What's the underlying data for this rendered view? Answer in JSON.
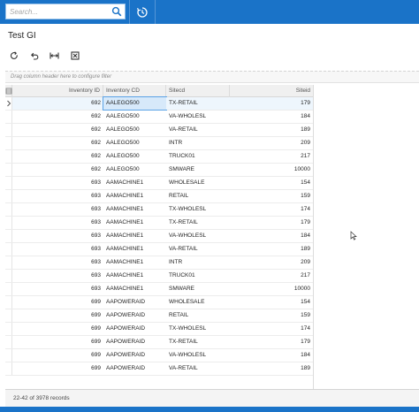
{
  "search": {
    "placeholder": "Search..."
  },
  "page": {
    "title": "Test GI"
  },
  "group_bar": {
    "hint": "Drag column header here to configure filter"
  },
  "grid": {
    "columns": [
      "Inventory ID",
      "Inventory CD",
      "Sitecd",
      "Siteid"
    ],
    "rows": [
      [
        "692",
        "AALEGO500",
        "TX-RETAIL",
        "179"
      ],
      [
        "692",
        "AALEGO500",
        "VA-WHOLESL",
        "184"
      ],
      [
        "692",
        "AALEGO500",
        "VA-RETAIL",
        "189"
      ],
      [
        "692",
        "AALEGO500",
        "INTR",
        "209"
      ],
      [
        "692",
        "AALEGO500",
        "TRUCK01",
        "217"
      ],
      [
        "692",
        "AALEGO500",
        "SMWARE",
        "10000"
      ],
      [
        "693",
        "AAMACHINE1",
        "WHOLESALE",
        "154"
      ],
      [
        "693",
        "AAMACHINE1",
        "RETAIL",
        "159"
      ],
      [
        "693",
        "AAMACHINE1",
        "TX-WHOLESL",
        "174"
      ],
      [
        "693",
        "AAMACHINE1",
        "TX-RETAIL",
        "179"
      ],
      [
        "693",
        "AAMACHINE1",
        "VA-WHOLESL",
        "184"
      ],
      [
        "693",
        "AAMACHINE1",
        "VA-RETAIL",
        "189"
      ],
      [
        "693",
        "AAMACHINE1",
        "INTR",
        "209"
      ],
      [
        "693",
        "AAMACHINE1",
        "TRUCK01",
        "217"
      ],
      [
        "693",
        "AAMACHINE1",
        "SMWARE",
        "10000"
      ],
      [
        "699",
        "AAPOWERAID",
        "WHOLESALE",
        "154"
      ],
      [
        "699",
        "AAPOWERAID",
        "RETAIL",
        "159"
      ],
      [
        "699",
        "AAPOWERAID",
        "TX-WHOLESL",
        "174"
      ],
      [
        "699",
        "AAPOWERAID",
        "TX-RETAIL",
        "179"
      ],
      [
        "699",
        "AAPOWERAID",
        "VA-WHOLESL",
        "184"
      ],
      [
        "699",
        "AAPOWERAID",
        "VA-RETAIL",
        "189"
      ]
    ],
    "current_row": 0
  },
  "footer": {
    "records": "22-42 of 3978 records"
  },
  "colors": {
    "topbar": "#1a73c8",
    "selection": "#d7e9fa"
  },
  "icons": {
    "search": "search-icon",
    "history": "history-icon",
    "refresh": "refresh-icon",
    "undo": "undo-icon",
    "fit": "fit-columns-icon",
    "export": "export-excel-icon",
    "column_config": "column-config-icon",
    "row_arrow": "current-row-arrow-icon"
  }
}
